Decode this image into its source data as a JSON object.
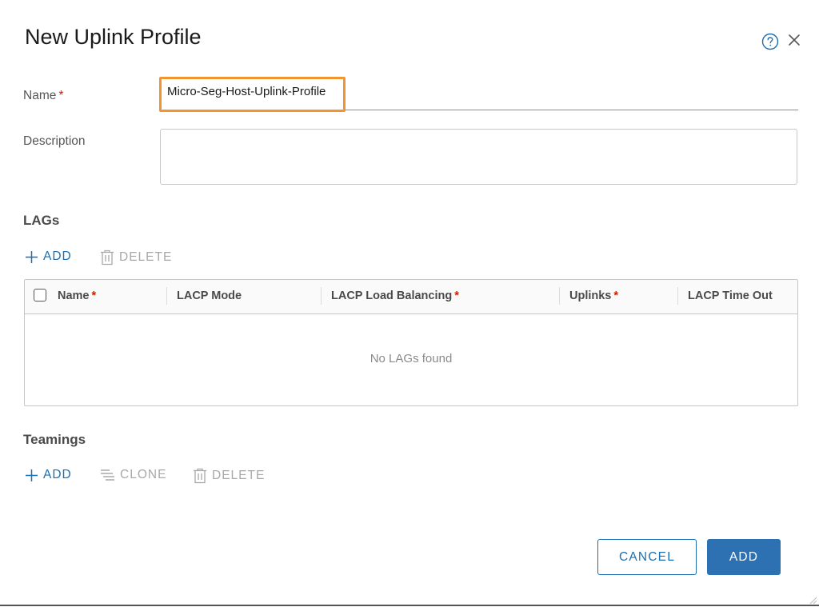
{
  "dialog": {
    "title": "New Uplink Profile",
    "help_icon": "help-circle-icon",
    "close_icon": "close-icon"
  },
  "form": {
    "name_label": "Name",
    "required_mark": "*",
    "name_value": "Micro-Seg-Host-Uplink-Profile",
    "description_label": "Description",
    "description_value": ""
  },
  "lags": {
    "title": "LAGs",
    "add_label": "ADD",
    "delete_label": "DELETE",
    "columns": [
      {
        "label": "Name",
        "required": true
      },
      {
        "label": "LACP Mode",
        "required": false
      },
      {
        "label": "LACP Load Balancing",
        "required": true
      },
      {
        "label": "Uplinks",
        "required": true
      },
      {
        "label": "LACP Time Out",
        "required": false
      }
    ],
    "empty_message": "No LAGs found"
  },
  "teamings": {
    "title": "Teamings",
    "add_label": "ADD",
    "clone_label": "CLONE",
    "delete_label": "DELETE"
  },
  "footer": {
    "cancel_label": "CANCEL",
    "add_label": "ADD"
  },
  "colors": {
    "accent": "#1b6fb1",
    "highlight": "#f0952f",
    "required": "#c92100",
    "disabled": "#a8a8a8"
  }
}
